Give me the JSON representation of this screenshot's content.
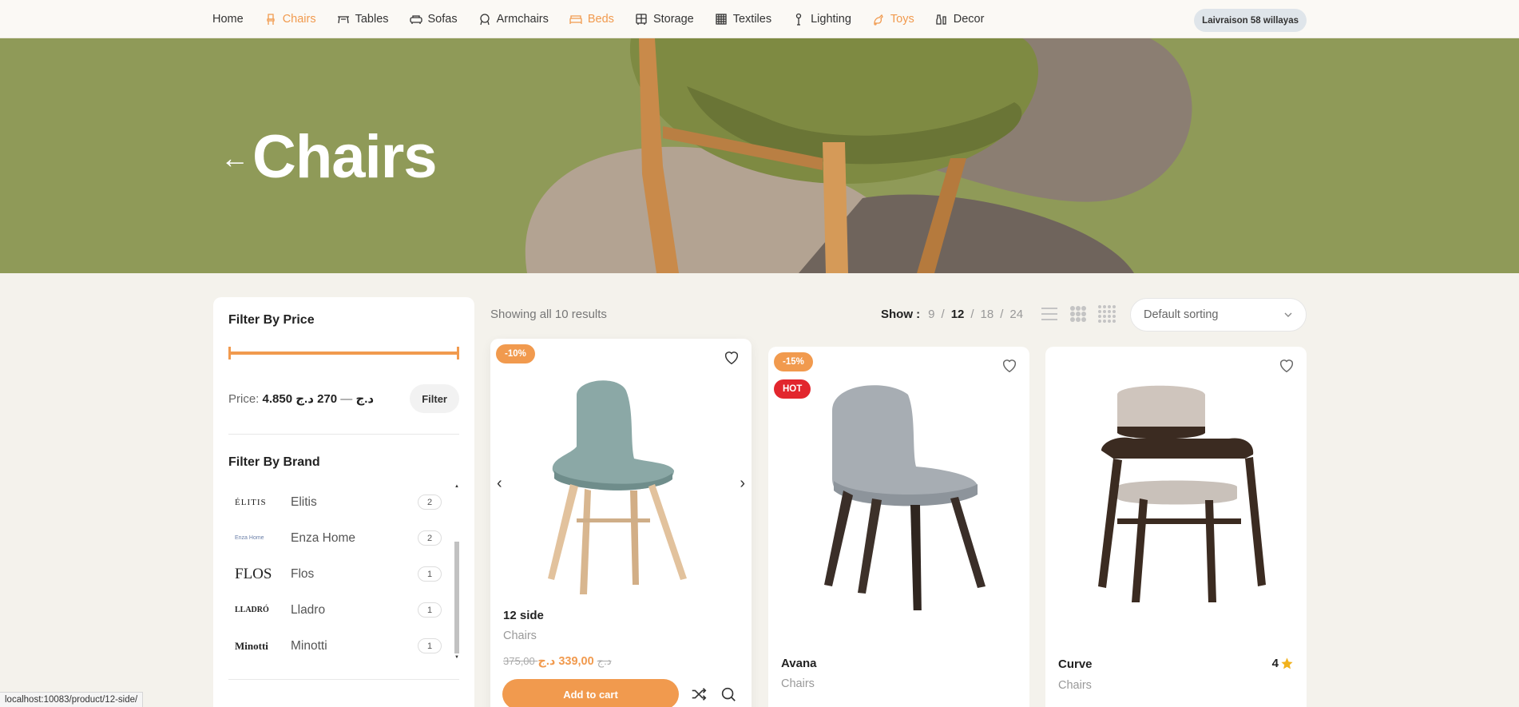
{
  "nav": {
    "items": [
      {
        "label": "Home",
        "icon": "",
        "accent": false
      },
      {
        "label": "Chairs",
        "icon": "chair-icon",
        "accent": true
      },
      {
        "label": "Tables",
        "icon": "table-icon",
        "accent": false
      },
      {
        "label": "Sofas",
        "icon": "sofa-icon",
        "accent": false
      },
      {
        "label": "Armchairs",
        "icon": "armchair-icon",
        "accent": false
      },
      {
        "label": "Beds",
        "icon": "bed-icon",
        "accent": true
      },
      {
        "label": "Storage",
        "icon": "storage-icon",
        "accent": false
      },
      {
        "label": "Textiles",
        "icon": "textile-icon",
        "accent": false
      },
      {
        "label": "Lighting",
        "icon": "lamp-icon",
        "accent": false
      },
      {
        "label": "Toys",
        "icon": "toy-icon",
        "accent": true
      },
      {
        "label": "Decor",
        "icon": "vase-icon",
        "accent": false
      }
    ],
    "delivery": "Laivraison 58 willayas"
  },
  "hero": {
    "back": "←",
    "title": "Chairs"
  },
  "sidebar": {
    "price_title": "Filter By Price",
    "price_label": "Price:",
    "price_min": "4.850 د.ج",
    "price_sep": "—",
    "price_max": "270 د.ج",
    "filter_button": "Filter",
    "brand_title": "Filter By Brand",
    "brands": [
      {
        "logo": "ÉLITIS",
        "name": "Elitis",
        "count": "2"
      },
      {
        "logo": "Enza Home",
        "name": "Enza Home",
        "count": "2"
      },
      {
        "logo": "FLOS",
        "name": "Flos",
        "count": "1"
      },
      {
        "logo": "LLADRÓ",
        "name": "Lladro",
        "count": "1"
      },
      {
        "logo": "Minotti",
        "name": "Minotti",
        "count": "1"
      }
    ]
  },
  "toolbar": {
    "results": "Showing all 10 results",
    "show_label": "Show :",
    "show_options": [
      "9",
      "12",
      "18",
      "24"
    ],
    "show_current": "12",
    "sorting": "Default sorting"
  },
  "products": [
    {
      "badges": [
        "-10%"
      ],
      "name": "12 side",
      "category": "Chairs",
      "old_price": "375,00 د.ج",
      "new_price": "339,00 د.ج",
      "button": "Add to cart"
    },
    {
      "badges": [
        "-15%",
        "HOT"
      ],
      "name": "Avana",
      "category": "Chairs"
    },
    {
      "badges": [],
      "name": "Curve",
      "category": "Chairs",
      "rating": "4"
    }
  ],
  "status_url": "localhost:10083/product/12-side/",
  "colors": {
    "accent": "#f19a4e",
    "hot": "#e2262d",
    "hero_bg": "#8f9a58"
  }
}
